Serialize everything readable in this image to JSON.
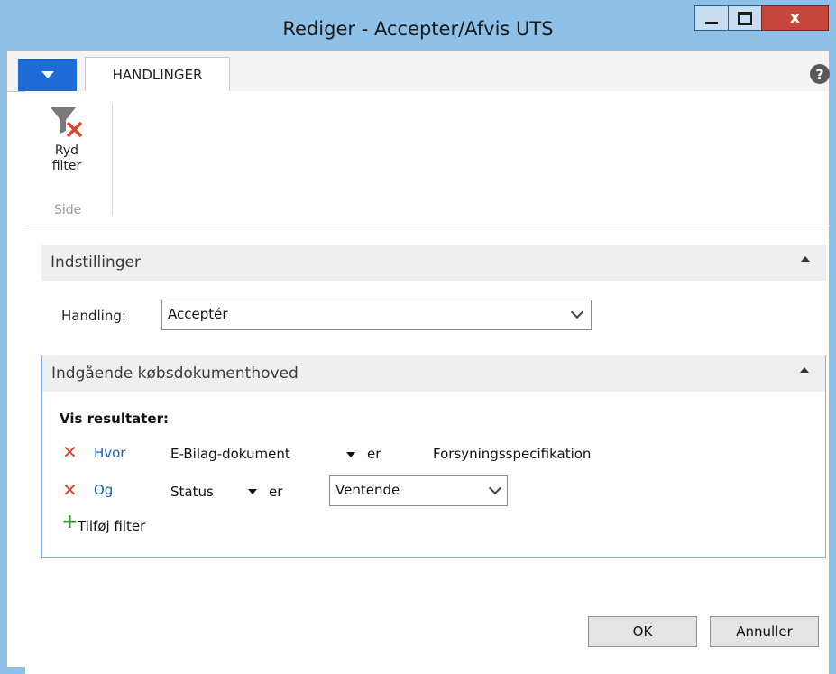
{
  "window": {
    "title": "Rediger - Accepter/Afvis UTS",
    "minimize_glyph": "minimize-icon",
    "maximize_glyph": "maximize-icon",
    "close_label": "x"
  },
  "ribbon": {
    "tab_label": "HANDLINGER",
    "help_label": "?",
    "clear_filter": {
      "label_line1": "Ryd",
      "label_line2": "filter",
      "icon": "funnel-clear-icon"
    },
    "group_label": "Side"
  },
  "settings": {
    "title": "Indstillinger",
    "action_label": "Handling:",
    "action_value": "Acceptér"
  },
  "filters": {
    "title": "Indgående købsdokumenthoved",
    "show_results_label": "Vis resultater:",
    "rows": [
      {
        "connector": "Hvor",
        "field": "E-Bilag-dokument",
        "operator": "er",
        "value": "Forsyningsspecifikation"
      },
      {
        "connector": "Og",
        "field": "Status",
        "operator": "er",
        "value": "Ventende"
      }
    ],
    "add_filter_label": "Tilføj filter"
  },
  "footer": {
    "ok_label": "OK",
    "cancel_label": "Annuller"
  },
  "colors": {
    "accent": "#1f6bd6",
    "remove": "#d8452d",
    "add": "#3d8b3d",
    "link": "#1a5fb4"
  }
}
